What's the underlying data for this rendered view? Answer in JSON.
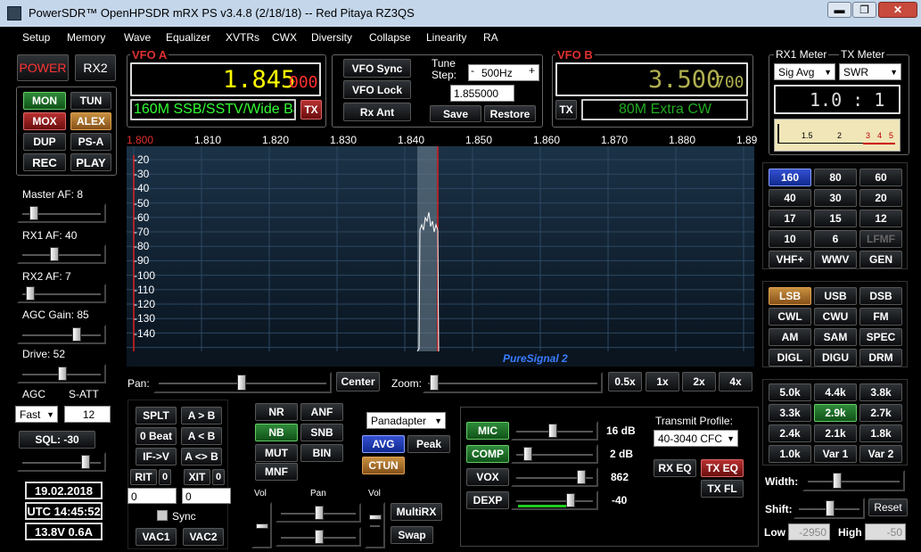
{
  "title": "PowerSDR™ OpenHPSDR mRX PS v3.4.8 (2/18/18)   --   Red Pitaya RZ3QS",
  "window": {
    "minimize": "▬",
    "maximize": "❐",
    "close": "✕"
  },
  "menu": [
    "Setup",
    "Memory",
    "Wave",
    "Equalizer",
    "XVTRs",
    "CWX",
    "Diversity",
    "Collapse",
    "Linearity",
    "RA"
  ],
  "left": {
    "power": "POWER",
    "rx2": "RX2",
    "grid": [
      [
        "MON",
        "TUN"
      ],
      [
        "MOX",
        "ALEX"
      ],
      [
        "DUP",
        "PS-A"
      ],
      [
        "REC",
        "PLAY"
      ]
    ],
    "master_af": "Master AF:  8",
    "rx1_af": "RX1 AF:  40",
    "rx2_af": "RX2 AF:  7",
    "agc_gain": "AGC Gain:  85",
    "drive": "Drive:  52",
    "agc": "AGC",
    "satt": "S-ATT",
    "agc_mode": "Fast",
    "satt_value": "12",
    "sql": "SQL: -30",
    "date": "19.02.2018",
    "utc": "UTC 14:45:52",
    "power_status": "13.8V 0.6A"
  },
  "vfoa": {
    "title": "VFO A",
    "freq": "1.845",
    "sub": "000",
    "band": "160M SSB/SSTV/Wide Ba",
    "tx": "TX"
  },
  "mid": {
    "vfo_sync": "VFO Sync",
    "vfo_lock": "VFO Lock",
    "rx_ant": "Rx Ant",
    "tune_step_label": "Tune Step:",
    "tune_step": "500Hz",
    "minus": "-",
    "plus": "+",
    "freq_input": "1.855000",
    "save": "Save",
    "restore": "Restore"
  },
  "vfob": {
    "title": "VFO B",
    "freq": "3.500",
    "sub": "700",
    "band": "80M Extra CW",
    "tx": "TX"
  },
  "meter": {
    "rx1_label": "RX1 Meter",
    "tx_label": "TX Meter",
    "rx1_mode": "Sig Avg",
    "tx_mode": "SWR",
    "reading": "1.0 : 1",
    "scale": [
      "1.5",
      "2",
      "3",
      "4",
      "5"
    ]
  },
  "spectrum": {
    "freq_labels": [
      "1.800",
      "1.810",
      "1.820",
      "1.830",
      "1.840",
      "1.850",
      "1.860",
      "1.870",
      "1.880",
      "1.89"
    ],
    "db_labels": [
      "-20",
      "-30",
      "-40",
      "-50",
      "-60",
      "-70",
      "-80",
      "-90",
      "-100",
      "-110",
      "-120",
      "-130",
      "-140"
    ],
    "puresignal": "PureSignal 2"
  },
  "pan": {
    "label": "Pan:",
    "center": "Center",
    "zoom_label": "Zoom:",
    "zooms": [
      "0.5x",
      "1x",
      "2x",
      "4x"
    ]
  },
  "bands": [
    [
      "160",
      "80",
      "60"
    ],
    [
      "40",
      "30",
      "20"
    ],
    [
      "17",
      "15",
      "12"
    ],
    [
      "10",
      "6",
      "LFMF"
    ],
    [
      "VHF+",
      "WWV",
      "GEN"
    ]
  ],
  "modes": [
    [
      "LSB",
      "USB",
      "DSB"
    ],
    [
      "CWL",
      "CWU",
      "FM"
    ],
    [
      "AM",
      "SAM",
      "SPEC"
    ],
    [
      "DIGL",
      "DIGU",
      "DRM"
    ]
  ],
  "filters": [
    [
      "5.0k",
      "4.4k",
      "3.8k"
    ],
    [
      "3.3k",
      "2.9k",
      "2.7k"
    ],
    [
      "2.4k",
      "2.1k",
      "1.8k"
    ],
    [
      "1.0k",
      "Var 1",
      "Var 2"
    ]
  ],
  "filter_ctrl": {
    "width": "Width:",
    "shift": "Shift:",
    "reset": "Reset",
    "low": "Low",
    "low_val": "-2950",
    "high": "High",
    "high_val": "-50"
  },
  "bottom": {
    "splt": "SPLT",
    "a_to_b": "A > B",
    "zero_beat": "0 Beat",
    "b_to_a": "A < B",
    "if_v": "IF->V",
    "a_swap_b": "A <> B",
    "rit": "RIT",
    "rit_v": "0",
    "xit": "XIT",
    "xit_v": "0",
    "rit_val": "0",
    "xit_val": "0",
    "sync": "Sync",
    "vac1": "VAC1",
    "vac2": "VAC2",
    "nr": "NR",
    "anf": "ANF",
    "nb": "NB",
    "snb": "SNB",
    "mut": "MUT",
    "bin": "BIN",
    "mnf": "MNF",
    "vol": "Vol",
    "pan": "Pan",
    "vol2": "Vol",
    "display_mode": "Panadapter",
    "avg": "AVG",
    "peak": "Peak",
    "ctun": "CTUN",
    "multirx": "MultiRX",
    "swap": "Swap",
    "mic": "MIC",
    "mic_val": "16 dB",
    "comp": "COMP",
    "comp_val": "2 dB",
    "vox": "VOX",
    "vox_val": "862",
    "dexp": "DEXP",
    "dexp_val": "-40",
    "tx_profile_label": "Transmit Profile:",
    "tx_profile": "40-3040 CFC",
    "rx_eq": "RX EQ",
    "tx_eq": "TX EQ",
    "tx_fl": "TX FL"
  }
}
